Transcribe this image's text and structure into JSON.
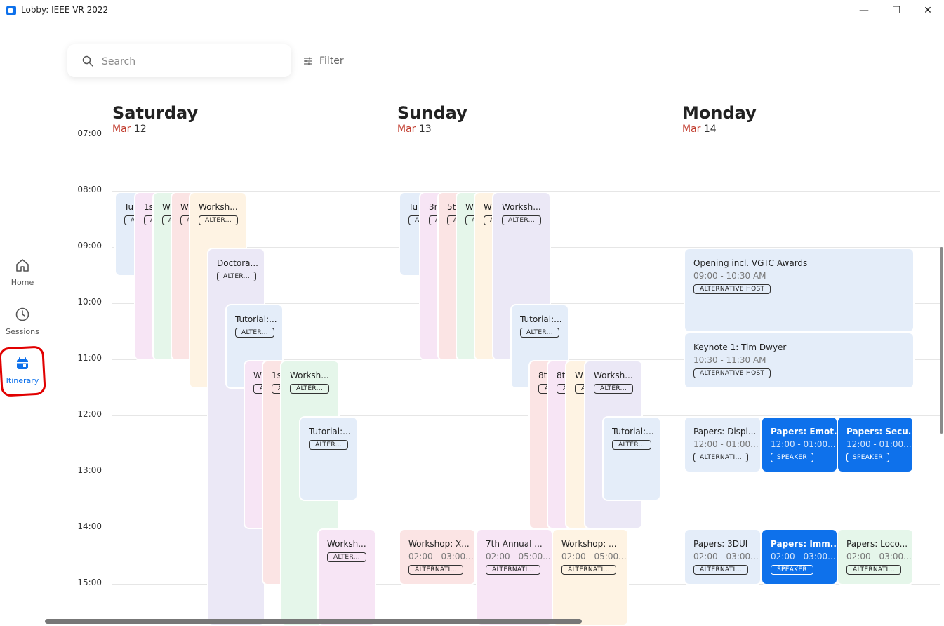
{
  "window": {
    "title": "Lobby: IEEE VR 2022",
    "minimize": "—",
    "maximize": "☐",
    "close": "✕"
  },
  "sidebar": {
    "items": [
      {
        "label": "Home",
        "icon": "home-icon"
      },
      {
        "label": "Sessions",
        "icon": "clock-icon"
      },
      {
        "label": "Itinerary",
        "icon": "calendar-icon",
        "active": true
      }
    ]
  },
  "search": {
    "placeholder": "Search",
    "filter_label": "Filter"
  },
  "days": [
    {
      "day": "Saturday",
      "month": "Mar",
      "date": "12"
    },
    {
      "day": "Sunday",
      "month": "Mar",
      "date": "13"
    },
    {
      "day": "Monday",
      "month": "Mar",
      "date": "14"
    }
  ],
  "times": [
    "07:00",
    "08:00",
    "09:00",
    "10:00",
    "11:00",
    "12:00",
    "13:00",
    "14:00",
    "15:00"
  ],
  "events": [
    {
      "title": "Tu",
      "badge": "A"
    },
    {
      "title": "1s",
      "badge": "A"
    },
    {
      "title": "W",
      "badge": "A"
    },
    {
      "title": "W",
      "badge": "A"
    },
    {
      "title": "Worksh...",
      "badge": "ALTER..."
    },
    {
      "title": "Doctora...",
      "badge": "ALTER..."
    },
    {
      "title": "Tutorial:...",
      "badge": "ALTER..."
    },
    {
      "title": "W",
      "badge": "A"
    },
    {
      "title": "1s",
      "badge": "A"
    },
    {
      "title": "Worksh...",
      "badge": "ALTER..."
    },
    {
      "title": "Tutorial:...",
      "badge": "ALTER..."
    },
    {
      "title": "Worksh...",
      "badge": "ALTER..."
    },
    {
      "title": "Tu",
      "badge": "A"
    },
    {
      "title": "3r",
      "badge": "A"
    },
    {
      "title": "5t",
      "badge": "A"
    },
    {
      "title": "W",
      "badge": "A"
    },
    {
      "title": "W",
      "badge": "A"
    },
    {
      "title": "Worksh...",
      "badge": "ALTER..."
    },
    {
      "title": "Tutorial:...",
      "badge": "ALTER..."
    },
    {
      "title": "8t",
      "badge": "A"
    },
    {
      "title": "8t",
      "badge": "A"
    },
    {
      "title": "W",
      "badge": "A"
    },
    {
      "title": "Worksh...",
      "badge": "ALTER..."
    },
    {
      "title": "Tutorial:...",
      "badge": "ALTER..."
    },
    {
      "title": "Workshop: X...",
      "time": "02:00 - 03:00...",
      "badge": "ALTERNATI..."
    },
    {
      "title": "7th Annual ...",
      "time": "02:00 - 05:00...",
      "badge": "ALTERNATI..."
    },
    {
      "title": "Workshop: ...",
      "time": "02:00 - 05:00...",
      "badge": "ALTERNATI..."
    },
    {
      "title": "Opening incl. VGTC Awards",
      "time": "09:00 - 10:30 AM",
      "badge": "ALTERNATIVE HOST"
    },
    {
      "title": "Keynote 1: Tim Dwyer",
      "time": "10:30 - 11:30 AM",
      "badge": "ALTERNATIVE HOST"
    },
    {
      "title": "Papers: Displ...",
      "time": "12:00 - 01:00...",
      "badge": "ALTERNATI..."
    },
    {
      "title": "Papers: Emot...",
      "time": "12:00 - 01:00...",
      "badge": "SPEAKER"
    },
    {
      "title": "Papers: Secu...",
      "time": "12:00 - 01:00...",
      "badge": "SPEAKER"
    },
    {
      "title": "Papers: 3DUI",
      "time": "02:00 - 03:00...",
      "badge": "ALTERNATI..."
    },
    {
      "title": "Papers: Imm...",
      "time": "02:00 - 03:00...",
      "badge": "SPEAKER"
    },
    {
      "title": "Papers: Loco...",
      "time": "02:00 - 03:00...",
      "badge": "ALTERNATI..."
    }
  ]
}
